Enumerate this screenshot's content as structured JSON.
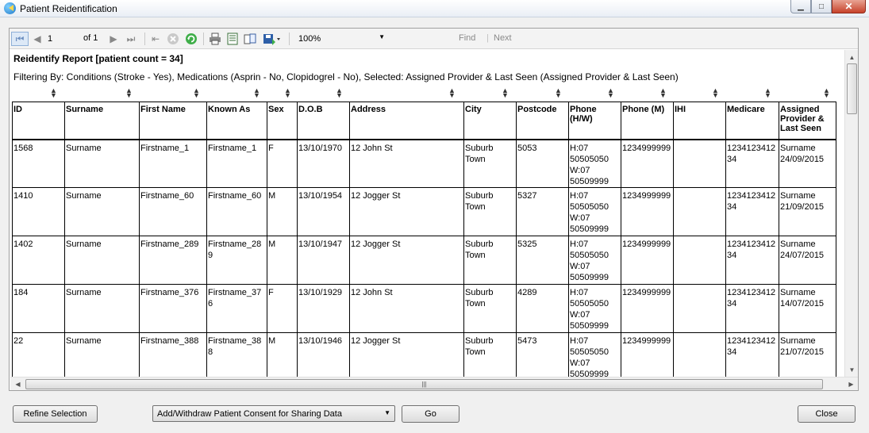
{
  "window": {
    "title": "Patient Reidentification",
    "minimize_glyph": "▁",
    "maximize_glyph": "□",
    "close_glyph": "✕"
  },
  "toolbar": {
    "page_current": "1",
    "page_of": "of 1",
    "zoom": "100%",
    "find_label": "Find",
    "find_separator": "|",
    "next_label": "Next",
    "icons": [
      "first-page-icon",
      "previous-page-icon",
      "next-page-icon",
      "last-page-icon",
      "back-icon",
      "stop-icon",
      "refresh-icon",
      "print-icon",
      "print-layout-icon",
      "page-setup-icon",
      "export-icon"
    ]
  },
  "report": {
    "title": "Reidentify Report  [patient count = 34]",
    "filter": "Filtering By: Conditions (Stroke - Yes), Medications (Asprin - No, Clopidogrel - No), Selected: Assigned Provider & Last Seen (Assigned Provider & Last Seen)",
    "columns": [
      "ID",
      "Surname",
      "First Name",
      "Known As",
      "Sex",
      "D.O.B",
      "Address",
      "City",
      "Postcode",
      "Phone (H/W)",
      "Phone (M)",
      "IHI",
      "Medicare",
      "Assigned Provider & Last Seen"
    ],
    "rows": [
      [
        "1568",
        "Surname",
        "Firstname_1",
        "Firstname_1",
        "F",
        "13/10/1970",
        "12 John St",
        "Suburb Town",
        "5053",
        "H:07 50505050 W:07 50509999",
        "1234999999",
        "",
        "1234123412 34",
        "Surname 24/09/2015"
      ],
      [
        "1410",
        "Surname",
        "Firstname_60",
        "Firstname_60",
        "M",
        "13/10/1954",
        "12 Jogger St",
        "Suburb Town",
        "5327",
        "H:07 50505050 W:07 50509999",
        "1234999999",
        "",
        "1234123412 34",
        "Surname 21/09/2015"
      ],
      [
        "1402",
        "Surname",
        "Firstname_289",
        "Firstname_28 9",
        "M",
        "13/10/1947",
        "12 Jogger St",
        "Suburb Town",
        "5325",
        "H:07 50505050 W:07 50509999",
        "1234999999",
        "",
        "1234123412 34",
        "Surname 24/07/2015"
      ],
      [
        "184",
        "Surname",
        "Firstname_376",
        "Firstname_37 6",
        "F",
        "13/10/1929",
        "12 John St",
        "Suburb Town",
        "4289",
        "H:07 50505050 W:07 50509999",
        "1234999999",
        "",
        "1234123412 34",
        "Surname 14/07/2015"
      ],
      [
        "22",
        "Surname",
        "Firstname_388",
        "Firstname_38 8",
        "M",
        "13/10/1946",
        "12 Jogger St",
        "Suburb Town",
        "5473",
        "H:07 50505050 W:07 50509999",
        "1234999999",
        "",
        "1234123412 34",
        "Surname 21/07/2015"
      ]
    ]
  },
  "buttons": {
    "refine": "Refine Selection",
    "consent_select": "Add/Withdraw Patient Consent for Sharing Data",
    "go": "Go",
    "close": "Close"
  },
  "colors": {
    "selected_toolbar_button": "#dde9f7",
    "close_window_button": "#c7422a"
  }
}
